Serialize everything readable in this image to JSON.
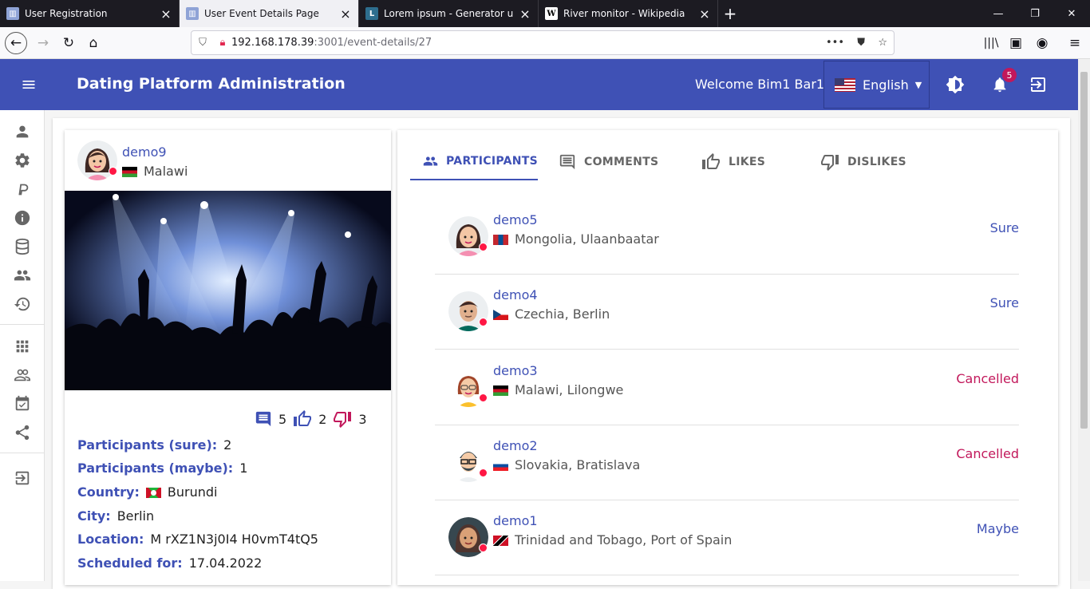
{
  "browser": {
    "tabs": [
      {
        "title": "User Registration",
        "favicon": "app-icon",
        "active": false
      },
      {
        "title": "User Event Details Page",
        "favicon": "app-icon",
        "active": true
      },
      {
        "title": "Lorem ipsum - Generator und I",
        "favicon": "L",
        "active": false
      },
      {
        "title": "River monitor - Wikipedia",
        "favicon": "W",
        "active": false
      }
    ],
    "url_host": "192.168.178.39",
    "url_path": ":3001/event-details/27"
  },
  "app": {
    "title": "Dating Platform Administration",
    "welcome": "Welcome Bim1 Bar1",
    "language": "English",
    "notification_count": "5",
    "brand_color": "#3f51b5"
  },
  "event": {
    "host_name": "demo9",
    "host_country": "Malawi",
    "comments_count": "5",
    "likes_count": "2",
    "dislikes_count": "3",
    "info": [
      {
        "label": "Participants (sure):",
        "value": "2"
      },
      {
        "label": "Participants (maybe):",
        "value": "1"
      },
      {
        "label": "Country:",
        "value": "Burundi"
      },
      {
        "label": "City:",
        "value": "Berlin"
      },
      {
        "label": "Location:",
        "value": "M rXZ1N3j0I4 H0vmT4tQ5"
      },
      {
        "label": "Scheduled for:",
        "value": "17.04.2022"
      }
    ]
  },
  "tabs": [
    {
      "label": "PARTICIPANTS",
      "icon": "group-icon"
    },
    {
      "label": "COMMENTS",
      "icon": "comment-icon"
    },
    {
      "label": "LIKES",
      "icon": "thumb-up-icon"
    },
    {
      "label": "DISLIKES",
      "icon": "thumb-down-icon"
    }
  ],
  "participants": [
    {
      "name": "demo5",
      "location": "Mongolia, Ulaanbaatar",
      "status": "Sure"
    },
    {
      "name": "demo4",
      "location": "Czechia, Berlin",
      "status": "Sure"
    },
    {
      "name": "demo3",
      "location": "Malawi, Lilongwe",
      "status": "Cancelled"
    },
    {
      "name": "demo2",
      "location": "Slovakia, Bratislava",
      "status": "Cancelled"
    },
    {
      "name": "demo1",
      "location": "Trinidad and Tobago, Port of Spain",
      "status": "Maybe"
    }
  ]
}
